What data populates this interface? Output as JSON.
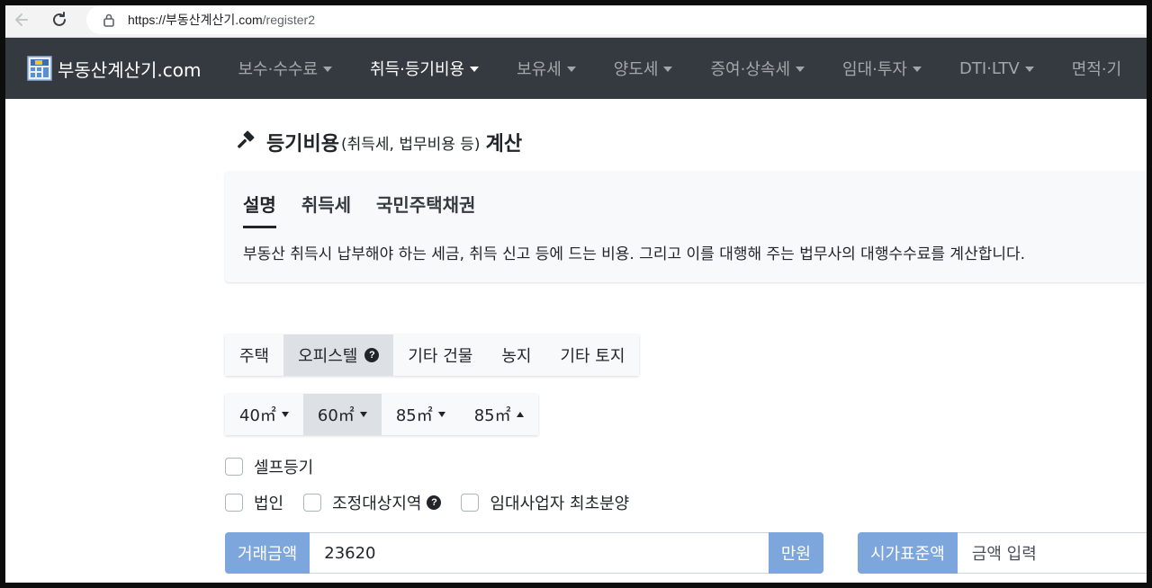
{
  "browser": {
    "url_host": "https://부동산계산기.com",
    "url_path": "/register2"
  },
  "navbar": {
    "brand": "부동산계산기.com",
    "menu": [
      {
        "label": "보수·수수료",
        "active": false
      },
      {
        "label": "취득·등기비용",
        "active": true
      },
      {
        "label": "보유세",
        "active": false
      },
      {
        "label": "양도세",
        "active": false
      },
      {
        "label": "증여·상속세",
        "active": false
      },
      {
        "label": "임대·투자",
        "active": false
      },
      {
        "label": "DTI·LTV",
        "active": false
      },
      {
        "label": "면적·기",
        "active": false
      }
    ]
  },
  "page": {
    "title_main": "등기비용",
    "title_paren": "(취득세, 법무비용 등)",
    "title_suffix": "계산"
  },
  "info": {
    "tabs": [
      "설명",
      "취득세",
      "국민주택채권"
    ],
    "active_tab": "설명",
    "description": "부동산 취득시 납부해야 하는 세금, 취득 신고 등에 드는 비용. 그리고 이를 대행해 주는 법무사의 대행수수료를 계산합니다."
  },
  "property_types": {
    "options": [
      "주택",
      "오피스텔",
      "기타 건물",
      "농지",
      "기타 토지"
    ],
    "selected": "오피스텔",
    "help_mark": "?"
  },
  "area_options": {
    "options": [
      "40㎡",
      "60㎡",
      "85㎡",
      "85㎡"
    ],
    "selected": "60㎡"
  },
  "checkboxes": {
    "self_registration": "셀프등기",
    "corporation": "법인",
    "regulated_area": "조정대상지역",
    "rental_first_sale": "임대사업자 최초분양"
  },
  "price_input": {
    "label": "거래금액",
    "value": "23620",
    "unit": "만원"
  },
  "standard_price": {
    "label": "시가표준액",
    "placeholder": "금액 입력"
  },
  "colors": {
    "navbar_bg": "#343a40",
    "addon_bg": "#7da7dc",
    "selected_bg": "#dde1e6"
  }
}
